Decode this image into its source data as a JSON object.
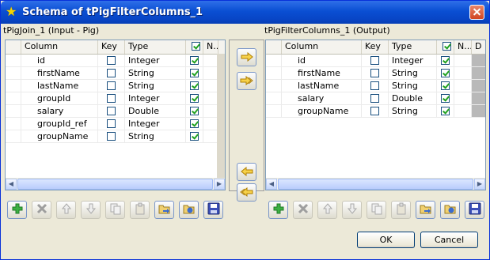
{
  "window": {
    "title": "Schema of tPigFilterColumns_1"
  },
  "input_panel": {
    "label": "tPigJoin_1 (Input - Pig)",
    "headers": {
      "column": "Column",
      "key": "Key",
      "type": "Type",
      "nullable": "N..."
    },
    "rows": [
      {
        "column": "id",
        "key": false,
        "type": "Integer",
        "nullable": true
      },
      {
        "column": "firstName",
        "key": false,
        "type": "String",
        "nullable": true
      },
      {
        "column": "lastName",
        "key": false,
        "type": "String",
        "nullable": true
      },
      {
        "column": "groupId",
        "key": false,
        "type": "Integer",
        "nullable": true
      },
      {
        "column": "salary",
        "key": false,
        "type": "Double",
        "nullable": true
      },
      {
        "column": "groupId_ref",
        "key": false,
        "type": "Integer",
        "nullable": true
      },
      {
        "column": "groupName",
        "key": false,
        "type": "String",
        "nullable": true
      }
    ]
  },
  "output_panel": {
    "label": "tPigFilterColumns_1 (Output)",
    "headers": {
      "column": "Column",
      "key": "Key",
      "type": "Type",
      "nullable": "N...",
      "default": "D"
    },
    "rows": [
      {
        "column": "id",
        "key": false,
        "type": "Integer",
        "nullable": true
      },
      {
        "column": "firstName",
        "key": false,
        "type": "String",
        "nullable": true
      },
      {
        "column": "lastName",
        "key": false,
        "type": "String",
        "nullable": true
      },
      {
        "column": "salary",
        "key": false,
        "type": "Double",
        "nullable": true
      },
      {
        "column": "groupName",
        "key": false,
        "type": "String",
        "nullable": true
      }
    ]
  },
  "transfer_buttons": [
    "copy-selected-right-icon",
    "copy-all-right-icon",
    "copy-selected-left-icon",
    "copy-all-left-icon"
  ],
  "toolbar_icons": [
    "add-icon",
    "remove-icon",
    "move-up-icon",
    "move-down-icon",
    "copy-icon",
    "paste-icon",
    "import-icon",
    "export-icon",
    "save-icon"
  ],
  "footer": {
    "ok_label": "OK",
    "cancel_label": "Cancel"
  },
  "colors": {
    "titlebar": "#0a4fd3",
    "check": "#21a121",
    "add": "#2e9a2e"
  }
}
